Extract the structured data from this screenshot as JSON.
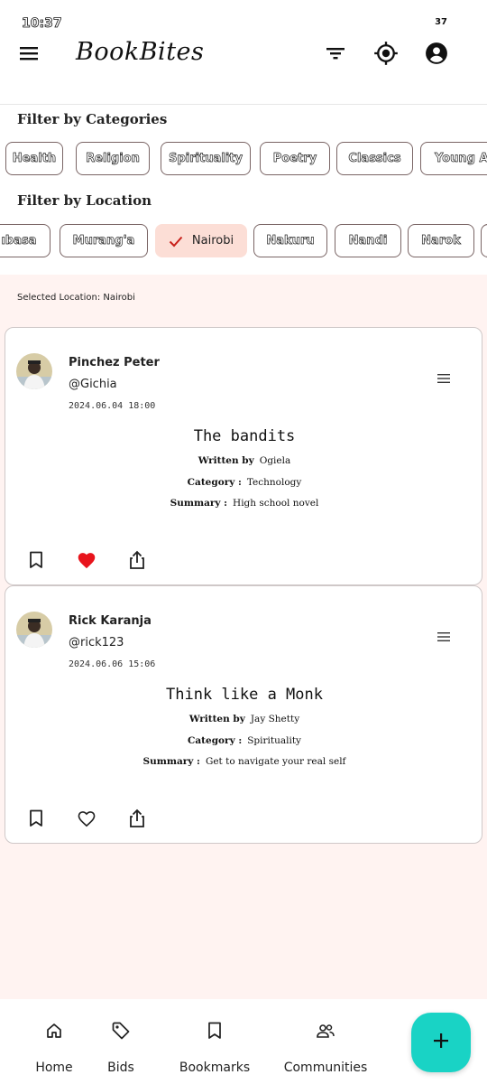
{
  "status": {
    "time": "10:37",
    "battery": "37"
  },
  "app": {
    "title": "BookBites"
  },
  "filters": {
    "category_title": "Filter by Categories",
    "categories": [
      "Health",
      "Religion",
      "Spirituality",
      "Poetry",
      "Classics",
      "Young A"
    ],
    "location_title": "Filter by Location",
    "locations": [
      "ıbasa",
      "Murang'a",
      "Nairobi",
      "Nakuru",
      "Nandi",
      "Narok"
    ],
    "selected_location_index": 2
  },
  "feed": {
    "selected_location_text": "Selected Location: Nairobi",
    "posts": [
      {
        "name": "Pinchez Peter",
        "handle": "@Gichia",
        "time": "2024.06.04 18:00",
        "book_title": "The bandits",
        "author_label": "Written by",
        "author": "Ogiela",
        "category_label": "Category :",
        "category": "Technology",
        "summary_label": "Summary :",
        "summary": "High school novel",
        "liked": true
      },
      {
        "name": "Rick Karanja",
        "handle": "@rick123",
        "time": "2024.06.06 15:06",
        "book_title": "Think like a Monk",
        "author_label": "Written by",
        "author": "Jay Shetty",
        "category_label": "Category :",
        "category": "Spirituality",
        "summary_label": "Summary :",
        "summary": "Get to navigate your real self",
        "liked": false
      }
    ]
  },
  "nav": {
    "items": [
      {
        "label": "Home",
        "icon": "home-icon"
      },
      {
        "label": "Bids",
        "icon": "tag-icon"
      },
      {
        "label": "Bookmarks",
        "icon": "bookmark-icon"
      },
      {
        "label": "Communities",
        "icon": "people-icon"
      }
    ]
  },
  "colors": {
    "fab": "#19d3c5",
    "selected_chip": "#fcded6",
    "heart": "#e8141c",
    "feed_bg": "#fff3f1"
  }
}
